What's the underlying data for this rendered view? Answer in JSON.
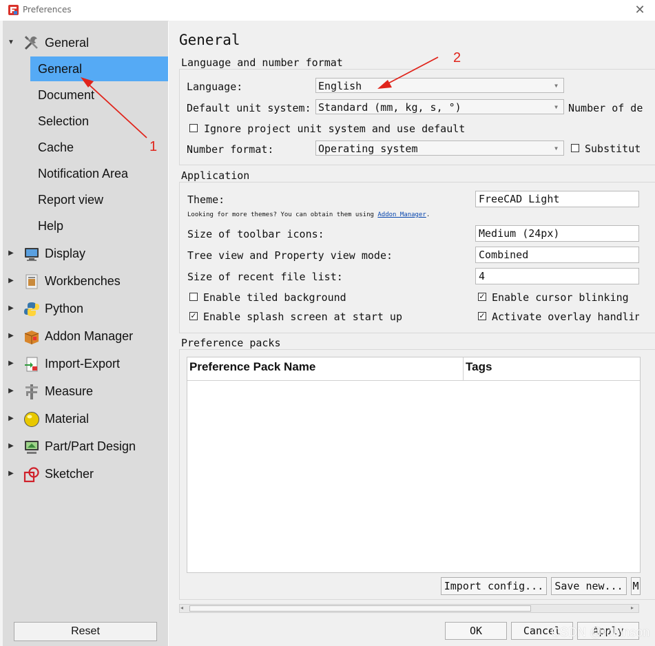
{
  "window": {
    "title": "Preferences",
    "close_glyph": "✕"
  },
  "sidebar": {
    "groups": [
      {
        "label": "General",
        "icon": "tools-icon",
        "expanded": true
      },
      {
        "label": "Display",
        "icon": "monitor-icon"
      },
      {
        "label": "Workbenches",
        "icon": "workbenches-icon"
      },
      {
        "label": "Python",
        "icon": "python-icon"
      },
      {
        "label": "Addon Manager",
        "icon": "addon-box-icon"
      },
      {
        "label": "Import-Export",
        "icon": "import-export-icon"
      },
      {
        "label": "Measure",
        "icon": "caliper-icon"
      },
      {
        "label": "Material",
        "icon": "material-sphere-icon"
      },
      {
        "label": "Part/Part Design",
        "icon": "part-design-icon"
      },
      {
        "label": "Sketcher",
        "icon": "sketcher-icon"
      }
    ],
    "general_children": [
      "General",
      "Document",
      "Selection",
      "Cache",
      "Notification Area",
      "Report view",
      "Help"
    ],
    "selected_child": "General",
    "reset_label": "Reset"
  },
  "main": {
    "page_title": "General",
    "lang_group": {
      "title": "Language and number format",
      "language_label": "Language:",
      "language_value": "English",
      "unit_label": "Default unit system:",
      "unit_value": "Standard (mm, kg, s, °)",
      "decimals_label": "Number of de",
      "ignore_project_label": "Ignore project unit system and use default",
      "ignore_project_checked": false,
      "number_format_label": "Number format:",
      "number_format_value": "Operating system",
      "substitute_label": "Substitut",
      "substitute_checked": false
    },
    "app_group": {
      "title": "Application",
      "theme_label": "Theme:",
      "theme_value": "FreeCAD Light",
      "themes_hint": "Looking for more themes? You can obtain them using",
      "addon_link": "Addon Manager",
      "themes_hint_end": ".",
      "toolbar_icons_label": "Size of toolbar icons:",
      "toolbar_icons_value": "Medium (24px)",
      "tree_mode_label": "Tree view and Property view mode:",
      "tree_mode_value": "Combined",
      "recent_files_label": "Size of recent file list:",
      "recent_files_value": "4",
      "tiled_bg_label": "Enable tiled background",
      "tiled_bg_checked": false,
      "cursor_blink_label": "Enable cursor blinking",
      "cursor_blink_checked": true,
      "splash_label": "Enable splash screen at start up",
      "splash_checked": true,
      "overlay_label": "Activate overlay handlin",
      "overlay_checked": true
    },
    "packs_group": {
      "title": "Preference packs",
      "columns": [
        "Preference Pack Name",
        "Tags"
      ],
      "rows": [],
      "import_label": "Import config...",
      "save_new_label": "Save new...",
      "more_label": "M"
    },
    "footer": {
      "ok_label": "OK",
      "cancel_label": "Cancel",
      "apply_label": "Apply"
    }
  },
  "annotations": {
    "arrow_1_label": "1",
    "arrow_2_label": "2",
    "color": "#e0241b"
  },
  "watermark": "CSDN @robinson",
  "colors": {
    "selection": "#55aaf5",
    "sidebar_bg": "#dcdcdc",
    "panel_bg": "#f0f0f0"
  }
}
